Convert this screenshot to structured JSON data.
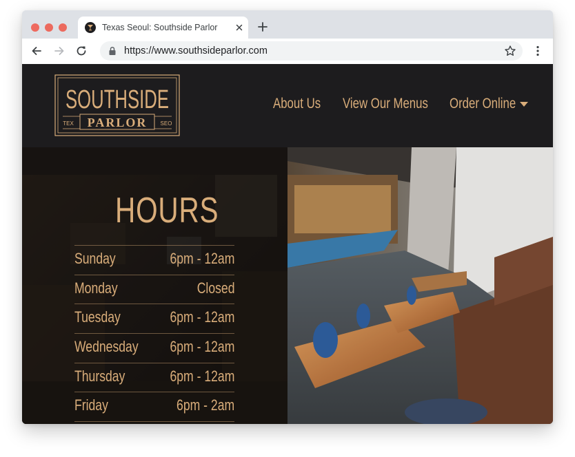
{
  "browser": {
    "tab_title": "Texas Seoul: Southside Parlor",
    "url": "https://www.southsideparlor.com"
  },
  "site": {
    "logo": {
      "top": "SOUTHSIDE",
      "main": "PARLOR",
      "left": "TEX",
      "right": "SEO"
    },
    "nav": [
      "About Us",
      "View Our Menus",
      "Order Online"
    ]
  },
  "hours": {
    "title": "HOURS",
    "rows": [
      {
        "day": "Sunday",
        "time": "6pm - 12am"
      },
      {
        "day": "Monday",
        "time": "Closed"
      },
      {
        "day": "Tuesday",
        "time": "6pm - 12am"
      },
      {
        "day": "Wednesday",
        "time": "6pm - 12am"
      },
      {
        "day": "Thursday",
        "time": "6pm - 12am"
      },
      {
        "day": "Friday",
        "time": "6pm - 2am"
      }
    ]
  },
  "colors": {
    "accent": "#d9ad7a",
    "page_bg": "#1d1c1e"
  }
}
